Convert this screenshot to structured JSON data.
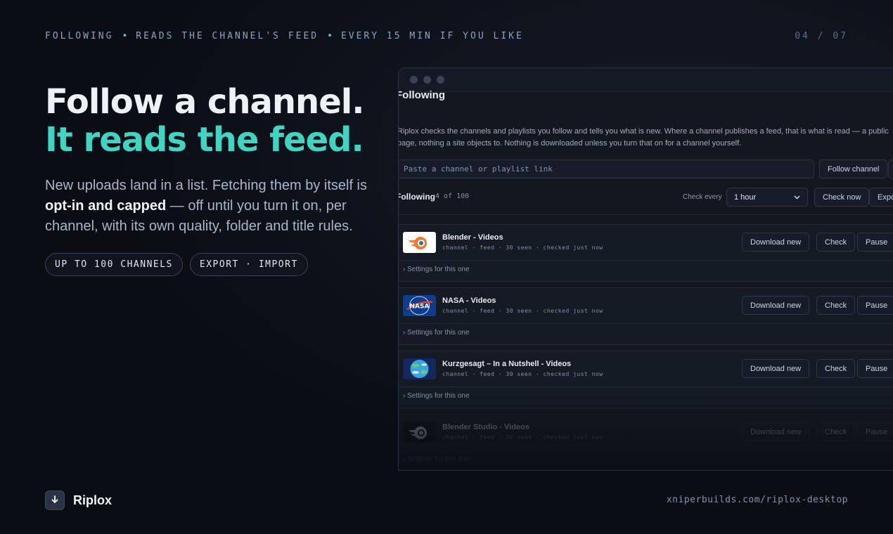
{
  "kicker": {
    "part1": "FOLLOWING",
    "part2": "READS THE CHANNEL'S FEED",
    "part3": "EVERY 15 MIN IF YOU LIKE",
    "separator": "•"
  },
  "pager": "04 / 07",
  "headline": {
    "line1": "Follow a channel.",
    "line2": "It reads the feed."
  },
  "lede": {
    "part1": "New uploads land in a list. Fetching them by itself is ",
    "bold": "opt-in and capped",
    "part2": " — off until you turn it on, per channel, with its own quality, folder and title rules."
  },
  "pills": [
    "UP TO 100 CHANNELS",
    "EXPORT · IMPORT"
  ],
  "brand": {
    "name": "Riplox",
    "icon": "download-arrow-icon"
  },
  "site": "xniperbuilds.com/riplox-desktop",
  "window": {
    "title": "Following",
    "description": "Riplox checks the channels and playlists you follow and tells you what is new. Where a channel publishes a feed, that is what is read — a public page, nothing a site objects to. Nothing is downloaded unless you turn that on for a channel yourself.",
    "paste_placeholder": "Paste a channel or playlist link",
    "follow_button": "Follow channel",
    "following_label": "Following",
    "following_count": "4 of 100",
    "check_every_label": "Check every",
    "check_every_value": "1 hour",
    "check_now": "Check now",
    "export": "Export",
    "rows": [
      {
        "name": "Blender - Videos",
        "meta": "channel · feed · 30 seen · checked just now",
        "download": "Download new",
        "check": "Check",
        "pause": "Pause",
        "settings": "Settings for this one"
      },
      {
        "name": "NASA - Videos",
        "meta": "channel · feed · 30 seen · checked just now",
        "download": "Download new",
        "check": "Check",
        "pause": "Pause",
        "settings": "Settings for this one"
      },
      {
        "name": "Kurzgesagt – In a Nutshell - Videos",
        "meta": "channel · feed · 30 seen · checked just now",
        "download": "Download new",
        "check": "Check",
        "pause": "Pause",
        "settings": "Settings for this one"
      },
      {
        "name": "Blender Studio - Videos",
        "meta": "channel · feed · 30 seen · checked just now",
        "download": "Download new",
        "check": "Check",
        "pause": "Pause",
        "settings": "Settings for this one"
      }
    ]
  },
  "colors": {
    "accent": "#3ed6c3",
    "background": "#0a0d14"
  }
}
